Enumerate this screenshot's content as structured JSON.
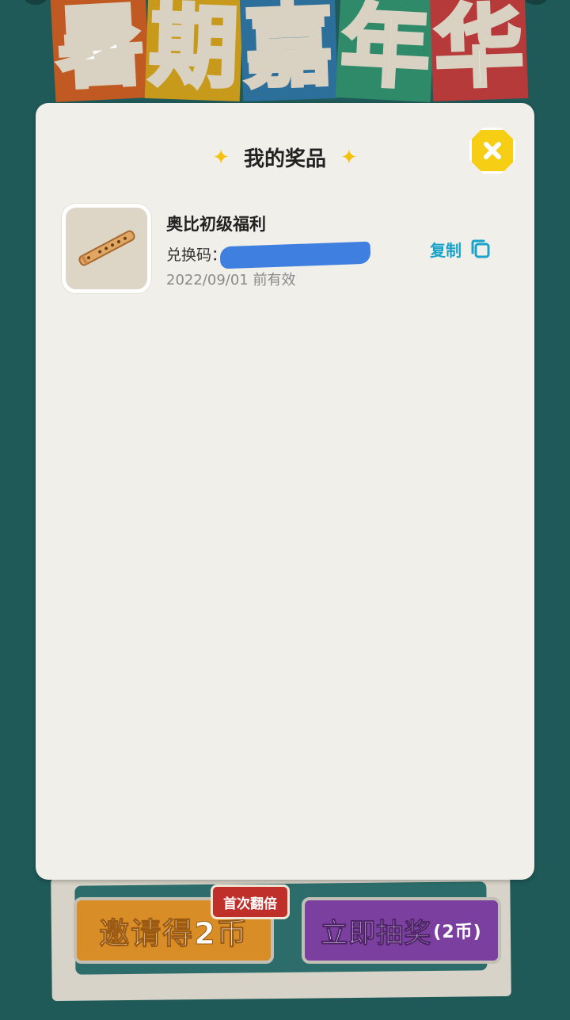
{
  "background": {
    "title_chars": [
      "暑",
      "期",
      "嘉",
      "年",
      "华"
    ],
    "invite_button_label": "邀请得2币",
    "double_badge": "首次翻倍",
    "draw_button_label": "立即抽奖",
    "draw_button_cost": "(2币)"
  },
  "modal": {
    "title": "我的奖品",
    "close_icon": "close-x-icon",
    "prizes": [
      {
        "name": "奥比初级福利",
        "code_label": "兑换码：",
        "expiry": "2022/09/01 前有效",
        "copy_label": "复制",
        "thumbnail_icon": "bamboo-flute-icon"
      }
    ]
  },
  "colors": {
    "background": "#1f5a58",
    "modal": "#f1efe9",
    "accent_yellow": "#f6cf14",
    "copy_blue": "#1aa3c9",
    "mask_blue": "#3f7fe0"
  }
}
